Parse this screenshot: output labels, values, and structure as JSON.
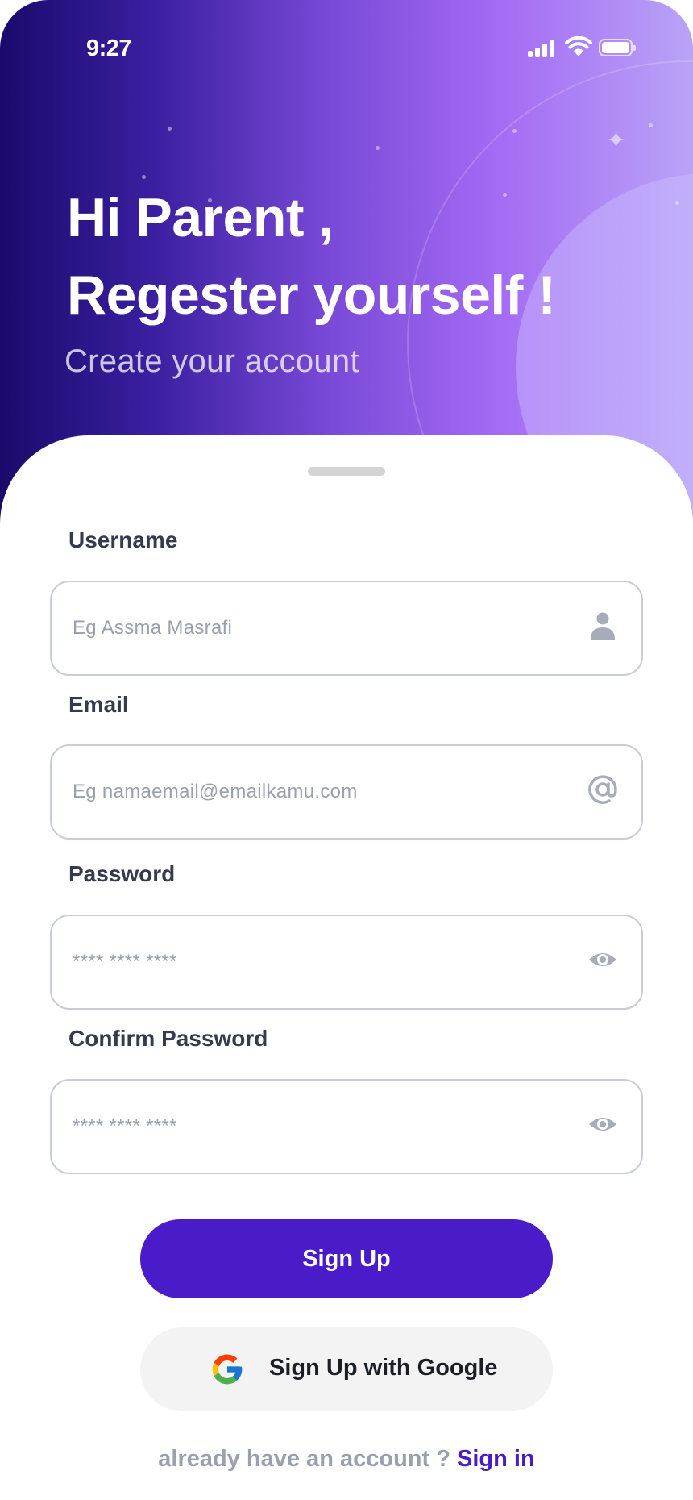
{
  "status_bar": {
    "time": "9:27",
    "icons": [
      "cellular-signal-icon",
      "wifi-icon",
      "battery-icon"
    ]
  },
  "header": {
    "greeting_line1": "Hi Parent ,",
    "greeting_line2": "Regester yourself  !",
    "subtitle": "Create your account"
  },
  "form": {
    "username": {
      "label": "Username",
      "placeholder": "Eg Assma Masrafi",
      "value": "",
      "icon": "user-icon"
    },
    "email": {
      "label": "Email",
      "placeholder": "Eg namaemail@emailkamu.com",
      "value": "",
      "icon": "at-sign-icon"
    },
    "password": {
      "label": "Password",
      "placeholder": "**** **** ****",
      "value": "",
      "icon": "eye-icon"
    },
    "confirm_password": {
      "label": "Confirm Password",
      "placeholder": "**** **** ****",
      "value": "",
      "icon": "eye-icon"
    }
  },
  "actions": {
    "sign_up": "Sign Up",
    "google_sign_up": "Sign Up with Google"
  },
  "footer": {
    "prompt": "already have an account ?",
    "link": "Sign in"
  },
  "colors": {
    "primary": "#4a1cc9",
    "gradient_start": "#1a0a6b",
    "gradient_end": "#b9a3f7",
    "label": "#353a4d",
    "placeholder": "#9aa0ae"
  }
}
